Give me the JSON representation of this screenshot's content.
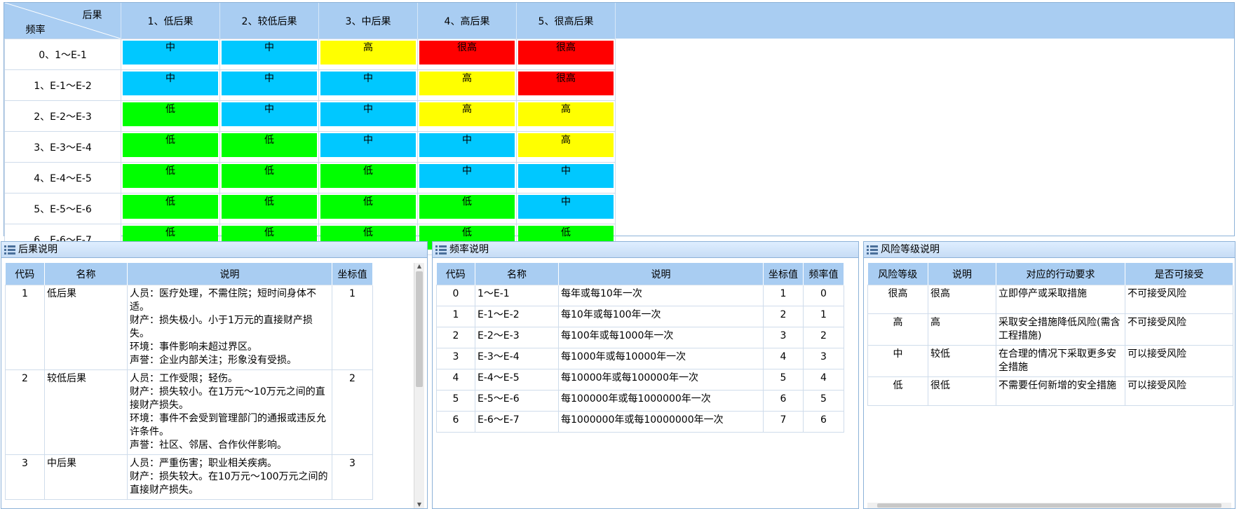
{
  "matrix": {
    "corner_top": "后果",
    "corner_bottom": "频率",
    "columns": [
      "1、低后果",
      "2、较低后果",
      "3、中后果",
      "4、高后果",
      "5、很高后果"
    ],
    "rows": [
      {
        "label": "0、1～E-1",
        "cells": [
          "中",
          "中",
          "高",
          "很高",
          "很高"
        ]
      },
      {
        "label": "1、E-1～E-2",
        "cells": [
          "中",
          "中",
          "中",
          "高",
          "很高"
        ]
      },
      {
        "label": "2、E-2～E-3",
        "cells": [
          "低",
          "中",
          "中",
          "高",
          "高"
        ]
      },
      {
        "label": "3、E-3～E-4",
        "cells": [
          "低",
          "低",
          "中",
          "中",
          "高"
        ]
      },
      {
        "label": "4、E-4～E-5",
        "cells": [
          "低",
          "低",
          "低",
          "中",
          "中"
        ]
      },
      {
        "label": "5、E-5～E-6",
        "cells": [
          "低",
          "低",
          "低",
          "低",
          "中"
        ]
      },
      {
        "label": "6、E-6～E-7",
        "cells": [
          "低",
          "低",
          "低",
          "低",
          "低"
        ]
      }
    ],
    "level_colors": {
      "低": "#00ff00",
      "中": "#00c8ff",
      "高": "#ffff00",
      "很高": "#ff0000"
    }
  },
  "consequence_panel": {
    "title": "后果说明",
    "headers": [
      "代码",
      "名称",
      "说明",
      "坐标值"
    ],
    "rows": [
      {
        "code": "1",
        "name": "低后果",
        "desc": [
          "人员：医疗处理，不需住院；短时间身体不适。",
          "财产：损失极小。小于1万元的直接财产损失。",
          "环境：事件影响未超过界区。",
          "声誉：企业内部关注；形象没有受损。"
        ],
        "coord": "1"
      },
      {
        "code": "2",
        "name": "较低后果",
        "desc": [
          "人员：工作受限；轻伤。",
          "财产：损失较小。在1万元～10万元之间的直接财产损失。",
          "环境：事件不会受到管理部门的通报或违反允许条件。",
          "声誉：社区、邻居、合作伙伴影响。"
        ],
        "coord": "2"
      },
      {
        "code": "3",
        "name": "中后果",
        "desc": [
          "人员：严重伤害；职业相关疾病。",
          "财产：损失较大。在10万元～100万元之间的直接财产损失。"
        ],
        "coord": "3"
      }
    ]
  },
  "frequency_panel": {
    "title": "频率说明",
    "headers": [
      "代码",
      "名称",
      "说明",
      "坐标值",
      "频率值"
    ],
    "rows": [
      {
        "code": "0",
        "name": "1～E-1",
        "desc": "每年或每10年一次",
        "coord": "1",
        "freq": "0"
      },
      {
        "code": "1",
        "name": "E-1～E-2",
        "desc": "每10年或每100年一次",
        "coord": "2",
        "freq": "1"
      },
      {
        "code": "2",
        "name": "E-2～E-3",
        "desc": "每100年或每1000年一次",
        "coord": "3",
        "freq": "2"
      },
      {
        "code": "3",
        "name": "E-3～E-4",
        "desc": "每1000年或每10000年一次",
        "coord": "4",
        "freq": "3"
      },
      {
        "code": "4",
        "name": "E-4～E-5",
        "desc": "每10000年或每100000年一次",
        "coord": "5",
        "freq": "4"
      },
      {
        "code": "5",
        "name": "E-5～E-6",
        "desc": "每100000年或每1000000年一次",
        "coord": "6",
        "freq": "5"
      },
      {
        "code": "6",
        "name": "E-6～E-7",
        "desc": "每1000000年或每10000000年一次",
        "coord": "7",
        "freq": "6"
      }
    ]
  },
  "risk_panel": {
    "title": "风险等级说明",
    "headers": [
      "风险等级",
      "说明",
      "对应的行动要求",
      "是否可接受"
    ],
    "rows": [
      {
        "level": "很高",
        "desc": "很高",
        "action": "立即停产或采取措施",
        "accept": "不可接受风险"
      },
      {
        "level": "高",
        "desc": "高",
        "action": "采取安全措施降低风险(需含工程措施)",
        "accept": "不可接受风险"
      },
      {
        "level": "中",
        "desc": "较低",
        "action": "在合理的情况下采取更多安全措施",
        "accept": "可以接受风险"
      },
      {
        "level": "低",
        "desc": "很低",
        "action": "不需要任何新增的安全措施",
        "accept": "可以接受风险"
      }
    ]
  }
}
